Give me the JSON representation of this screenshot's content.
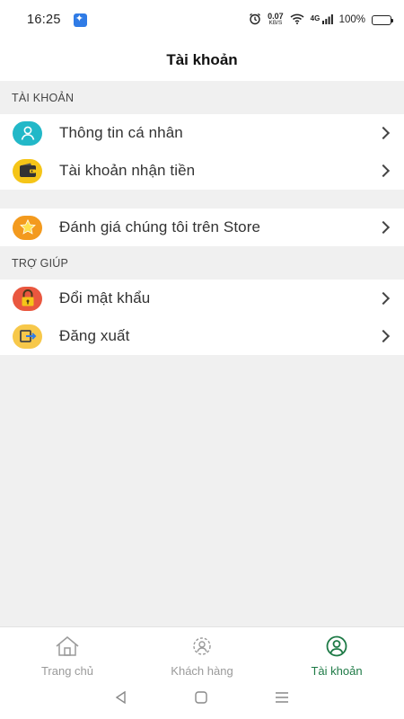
{
  "status_bar": {
    "time": "16:25",
    "net_speed_value": "0.07",
    "net_speed_unit": "KB/S",
    "signal_label": "4G",
    "battery_percent": "100%",
    "battery_level": 1.0
  },
  "header": {
    "title": "Tài khoản"
  },
  "sections": {
    "account_label": "TÀI KHOẢN",
    "help_label": "TRỢ GIÚP"
  },
  "account_items": [
    {
      "label": "Thông tin cá nhân",
      "icon": "user-profile-icon"
    },
    {
      "label": "Tài khoản nhận tiền",
      "icon": "wallet-icon"
    }
  ],
  "rate_item": {
    "label": "Đánh giá chúng tôi trên Store",
    "icon": "star-icon"
  },
  "help_items": [
    {
      "label": "Đổi mật khẩu",
      "icon": "lock-icon"
    },
    {
      "label": "Đăng xuất",
      "icon": "logout-icon"
    }
  ],
  "bottom_nav": [
    {
      "label": "Trang chủ",
      "icon": "home-icon",
      "active": false
    },
    {
      "label": "Khách hàng",
      "icon": "customers-icon",
      "active": false
    },
    {
      "label": "Tài khoản",
      "icon": "account-icon",
      "active": true
    }
  ],
  "colors": {
    "active_tab": "#1e7a46",
    "inactive_tab": "#9a9a9a",
    "page_bg": "#f0f0f0"
  }
}
